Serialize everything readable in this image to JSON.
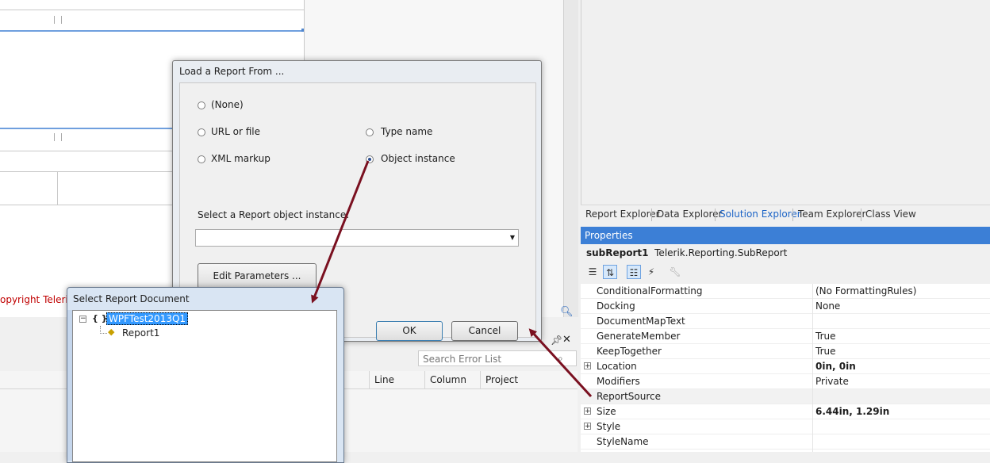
{
  "designer": {
    "copyright_text": "opyright Telerik"
  },
  "error_list": {
    "search_placeholder": "Search Error List",
    "pin_icon": "pin-icon",
    "close_icon": "close-icon",
    "columns": [
      "Line",
      "Column",
      "Project"
    ]
  },
  "tabs": [
    "Report Explorer",
    "Data Explorer",
    "Solution Explorer",
    "Team Explorer",
    "Class View"
  ],
  "tabs_active": "Solution Explorer",
  "properties": {
    "title": "Properties",
    "object_name": "subReport1",
    "object_type": "Telerik.Reporting.SubReport",
    "rows": [
      {
        "name": "ConditionalFormatting",
        "value": "(No FormattingRules)",
        "expandable": false,
        "bold": false
      },
      {
        "name": "Docking",
        "value": "None",
        "expandable": false,
        "bold": false
      },
      {
        "name": "DocumentMapText",
        "value": "",
        "expandable": false,
        "bold": false
      },
      {
        "name": "GenerateMember",
        "value": "True",
        "expandable": false,
        "bold": false
      },
      {
        "name": "KeepTogether",
        "value": "True",
        "expandable": false,
        "bold": false
      },
      {
        "name": "Location",
        "value": "0in, 0in",
        "expandable": true,
        "bold": true
      },
      {
        "name": "Modifiers",
        "value": "Private",
        "expandable": false,
        "bold": false
      },
      {
        "name": "ReportSource",
        "value": "",
        "expandable": false,
        "bold": false
      },
      {
        "name": "Size",
        "value": "6.44in, 1.29in",
        "expandable": true,
        "bold": true
      },
      {
        "name": "Style",
        "value": "",
        "expandable": true,
        "bold": false
      },
      {
        "name": "StyleName",
        "value": "",
        "expandable": false,
        "bold": false
      }
    ]
  },
  "load_dialog": {
    "title": "Load a Report From ...",
    "options": {
      "none": "(None)",
      "url": "URL or file",
      "type_name": "Type name",
      "xml": "XML markup",
      "object_instance": "Object instance"
    },
    "selected_option": "Object instance",
    "select_label": "Select a Report object instance:",
    "combo_value": "",
    "edit_params_label": "Edit Parameters ...",
    "ok_label": "OK",
    "cancel_label": "Cancel"
  },
  "select_dialog": {
    "title": "Select Report Document",
    "tree_toggle": "−",
    "namespace_icon": "{ }",
    "project_name": "WPFTest2013Q1",
    "report_name": "Report1"
  },
  "colors": {
    "accent": "#3c7fd6",
    "arrow": "#7a1020",
    "copyright": "#c00000"
  }
}
